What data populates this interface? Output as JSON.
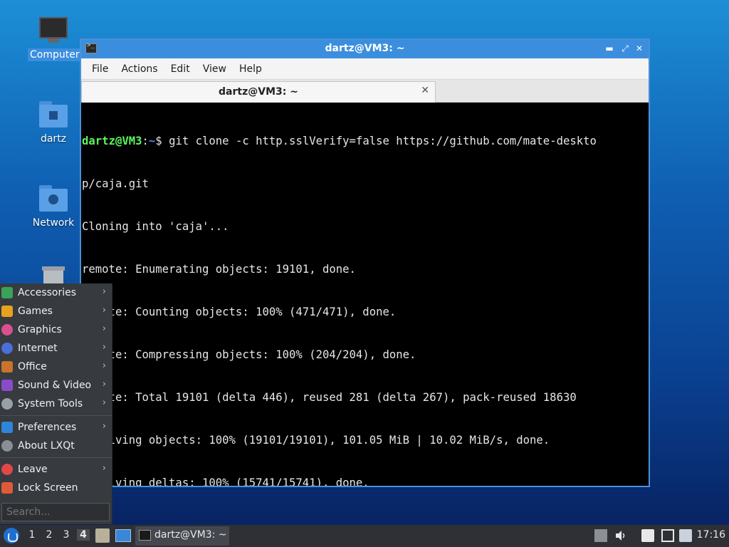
{
  "desktop": {
    "icons": [
      {
        "label": "Computer",
        "icon": "computer-icon"
      },
      {
        "label": "dartz",
        "icon": "home-folder-icon"
      },
      {
        "label": "Network",
        "icon": "network-folder-icon"
      },
      {
        "label": "",
        "icon": "trash-icon"
      }
    ]
  },
  "window": {
    "title": "dartz@VM3: ~",
    "menu": [
      "File",
      "Actions",
      "Edit",
      "View",
      "Help"
    ],
    "tab_label": "dartz@VM3: ~",
    "tab_close": "✕"
  },
  "terminal": {
    "prompt_user": "dartz@VM3",
    "prompt_colon": ":",
    "prompt_path": "~",
    "prompt_dollar": "$ ",
    "command": "git clone -c http.sslVerify=false https://github.com/mate-deskto",
    "command_wrap": "p/caja.git",
    "output": [
      "Cloning into 'caja'...",
      "remote: Enumerating objects: 19101, done.",
      "remote: Counting objects: 100% (471/471), done.",
      "remote: Compressing objects: 100% (204/204), done.",
      "remote: Total 19101 (delta 446), reused 281 (delta 267), pack-reused 18630",
      "Receiving objects: 100% (19101/19101), 101.05 MiB | 10.02 MiB/s, done.",
      "Resolving deltas: 100% (15741/15741), done."
    ]
  },
  "start_menu": {
    "categories": [
      {
        "label": "Accessories",
        "icon": "accessories-icon",
        "color": "#3aa35a"
      },
      {
        "label": "Games",
        "icon": "games-icon",
        "color": "#e8a31c"
      },
      {
        "label": "Graphics",
        "icon": "graphics-icon",
        "color": "#d9508f"
      },
      {
        "label": "Internet",
        "icon": "internet-icon",
        "color": "#4a6fd8"
      },
      {
        "label": "Office",
        "icon": "office-icon",
        "color": "#c9742a"
      },
      {
        "label": "Sound & Video",
        "icon": "sound-video-icon",
        "color": "#8a4bc9"
      },
      {
        "label": "System Tools",
        "icon": "system-tools-icon",
        "color": "#9aa0a8"
      }
    ],
    "settings": [
      {
        "label": "Preferences",
        "icon": "preferences-icon",
        "color": "#2f86d9"
      },
      {
        "label": "About LXQt",
        "icon": "info-icon",
        "color": "#8a8f96"
      }
    ],
    "session": [
      {
        "label": "Leave",
        "icon": "power-icon",
        "color": "#e04848"
      },
      {
        "label": "Lock Screen",
        "icon": "lock-icon",
        "color": "#e05a3a"
      }
    ],
    "search_placeholder": "Search..."
  },
  "taskbar": {
    "workspaces": [
      "1",
      "2",
      "3",
      "4"
    ],
    "active_workspace": "4",
    "task_title": "dartz@VM3: ~",
    "clock": "17:16"
  },
  "colors": {
    "accent": "#3b8ede",
    "prompt_user": "#5bf75b",
    "prompt_path": "#5a7df5"
  }
}
